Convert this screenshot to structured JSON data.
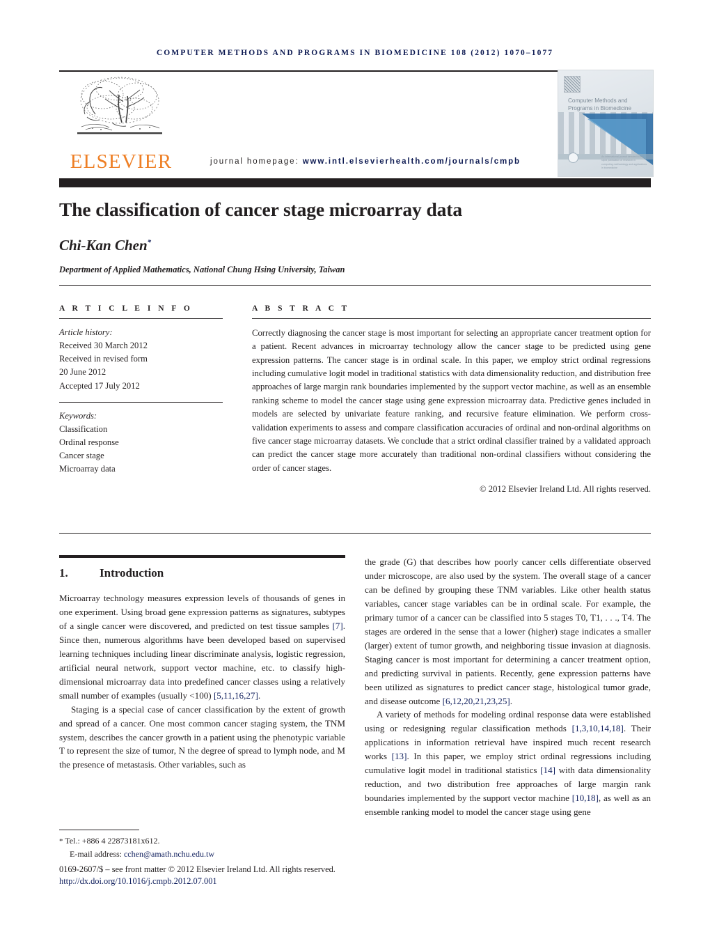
{
  "running_head": "COMPUTER METHODS AND PROGRAMS IN BIOMEDICINE 108 (2012) 1070–1077",
  "masthead": {
    "publisher_wordmark": "ELSEVIER",
    "homepage_label": "journal homepage:",
    "homepage_url": "www.intl.elsevierhealth.com/journals/cmpb",
    "cover": {
      "title": "Computer Methods and Programs in Biomedicine",
      "footer_text": "An international journal devoted to the rapid publication of research in computing methodology and applications in biomedicine"
    }
  },
  "article": {
    "title": "The classification of cancer stage microarray data",
    "author": "Chi-Kan Chen",
    "author_mark": "*",
    "affiliation": "Department of Applied Mathematics, National Chung Hsing University, Taiwan"
  },
  "article_info": {
    "heading": "A R T I C L E   I N F O",
    "history_label": "Article history:",
    "history": [
      "Received 30 March 2012",
      "Received in revised form",
      "20 June 2012",
      "Accepted 17 July 2012"
    ],
    "keywords_label": "Keywords:",
    "keywords": [
      "Classification",
      "Ordinal response",
      "Cancer stage",
      "Microarray data"
    ]
  },
  "abstract": {
    "heading": "A B S T R A C T",
    "text": "Correctly diagnosing the cancer stage is most important for selecting an appropriate cancer treatment option for a patient. Recent advances in microarray technology allow the cancer stage to be predicted using gene expression patterns. The cancer stage is in ordinal scale. In this paper, we employ strict ordinal regressions including cumulative logit model in traditional statistics with data dimensionality reduction, and distribution free approaches of large margin rank boundaries implemented by the support vector machine, as well as an ensemble ranking scheme to model the cancer stage using gene expression microarray data. Predictive genes included in models are selected by univariate feature ranking, and recursive feature elimination. We perform cross-validation experiments to assess and compare classification accuracies of ordinal and non-ordinal algorithms on five cancer stage microarray datasets. We conclude that a strict ordinal classifier trained by a validated approach can predict the cancer stage more accurately than traditional non-ordinal classifiers without considering the order of cancer stages.",
    "copyright": "© 2012 Elsevier Ireland Ltd. All rights reserved."
  },
  "introduction": {
    "number": "1.",
    "heading": "Introduction",
    "left_paragraphs": [
      "Microarray technology measures expression levels of thousands of genes in one experiment. Using broad gene expression patterns as signatures, subtypes of a single cancer were discovered, and predicted on test tissue samples [7]. Since then, numerous algorithms have been developed based on supervised learning techniques including linear discriminate analysis, logistic regression, artificial neural network, support vector machine, etc. to classify high-dimensional microarray data into predefined cancer classes using a relatively small number of examples (usually <100) [5,11,16,27].",
      "Staging is a special case of cancer classification by the extent of growth and spread of a cancer. One most common cancer staging system, the TNM system, describes the cancer growth in a patient using the phenotypic variable T to represent the size of tumor, N the degree of spread to lymph node, and M the presence of metastasis. Other variables, such as"
    ],
    "right_paragraphs": [
      "the grade (G) that describes how poorly cancer cells differentiate observed under microscope, are also used by the system. The overall stage of a cancer can be defined by grouping these TNM variables. Like other health status variables, cancer stage variables can be in ordinal scale. For example, the primary tumor of a cancer can be classified into 5 stages T0, T1, . . ., T4. The stages are ordered in the sense that a lower (higher) stage indicates a smaller (larger) extent of tumor growth, and neighboring tissue invasion at diagnosis. Staging cancer is most important for determining a cancer treatment option, and predicting survival in patients. Recently, gene expression patterns have been utilized as signatures to predict cancer stage, histological tumor grade, and disease outcome [6,12,20,21,23,25].",
      "A variety of methods for modeling ordinal response data were established using or redesigning regular classification methods [1,3,10,14,18]. Their applications in information retrieval have inspired much recent research works [13]. In this paper, we employ strict ordinal regressions including cumulative logit model in traditional statistics [14] with data dimensionality reduction, and two distribution free approaches of large margin rank boundaries implemented by the support vector machine [10,18], as well as an ensemble ranking model to model the cancer stage using gene"
    ]
  },
  "footnote": {
    "mark": "*",
    "tel": "Tel.: +886 4 22873181x612.",
    "email_label": "E-mail address:",
    "email": "cchen@amath.nchu.edu.tw",
    "imprint": "0169-2607/$ – see front matter © 2012 Elsevier Ireland Ltd. All rights reserved.",
    "doi": "http://dx.doi.org/10.1016/j.cmpb.2012.07.001"
  },
  "colors": {
    "navy": "#0d1a52",
    "link": "#11205e",
    "elsevier_orange": "#ee7f25",
    "ink": "#231f20"
  }
}
